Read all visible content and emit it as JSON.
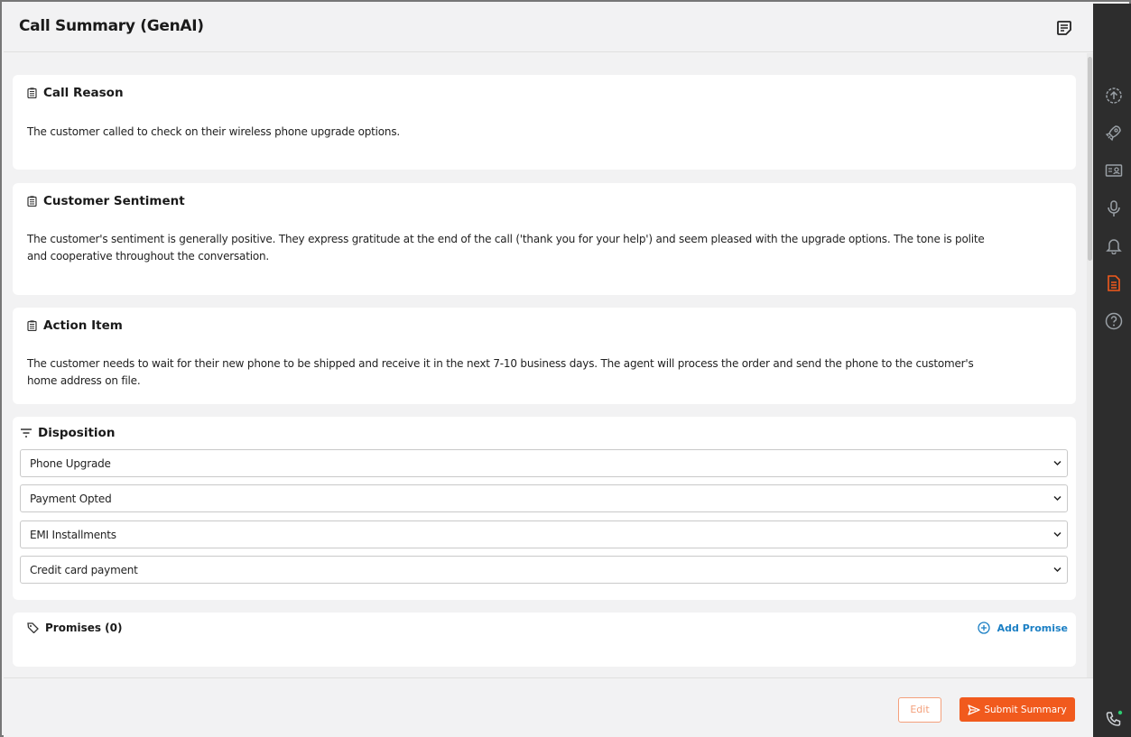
{
  "header": {
    "title": "Call Summary (GenAI)",
    "notes_icon": "sticky-note-icon"
  },
  "sections": [
    {
      "title": "Call Reason",
      "icon": "clipboard-icon",
      "body": "The customer called to check on their wireless phone upgrade options."
    },
    {
      "title": "Customer Sentiment",
      "icon": "clipboard-icon",
      "body": "The customer's sentiment is generally positive. They express gratitude at the end of the call ('thank you for your help') and seem pleased with the upgrade options. The tone is polite and cooperative throughout the conversation."
    },
    {
      "title": "Action Item",
      "icon": "clipboard-icon",
      "body": "The customer needs to wait for their new phone to be shipped and receive it in the next 7-10 business days. The agent will process the order and send the phone to the customer's home address on file."
    }
  ],
  "disposition": {
    "title": "Disposition",
    "icon": "filter-icon",
    "selects": [
      "Phone Upgrade",
      "Payment Opted",
      "EMI Installments",
      "Credit card payment"
    ]
  },
  "promises": {
    "title": "Promises (0)",
    "icon": "tag-icon",
    "add_label": "Add Promise"
  },
  "footer": {
    "edit_label": "Edit",
    "submit_label": "Submit Summary"
  },
  "rail": {
    "icons": [
      "upload-circle-icon",
      "rocket-icon",
      "contact-card-icon",
      "microphone-icon",
      "bell-icon",
      "document-icon",
      "help-icon",
      "phone-icon"
    ],
    "active": "document-icon"
  },
  "colors": {
    "accent": "#f15a1d",
    "link": "#1b7fc4",
    "rail_bg": "#2d2d2d",
    "rail_icon": "#9aa0a6",
    "online_dot": "#2ecc71"
  }
}
